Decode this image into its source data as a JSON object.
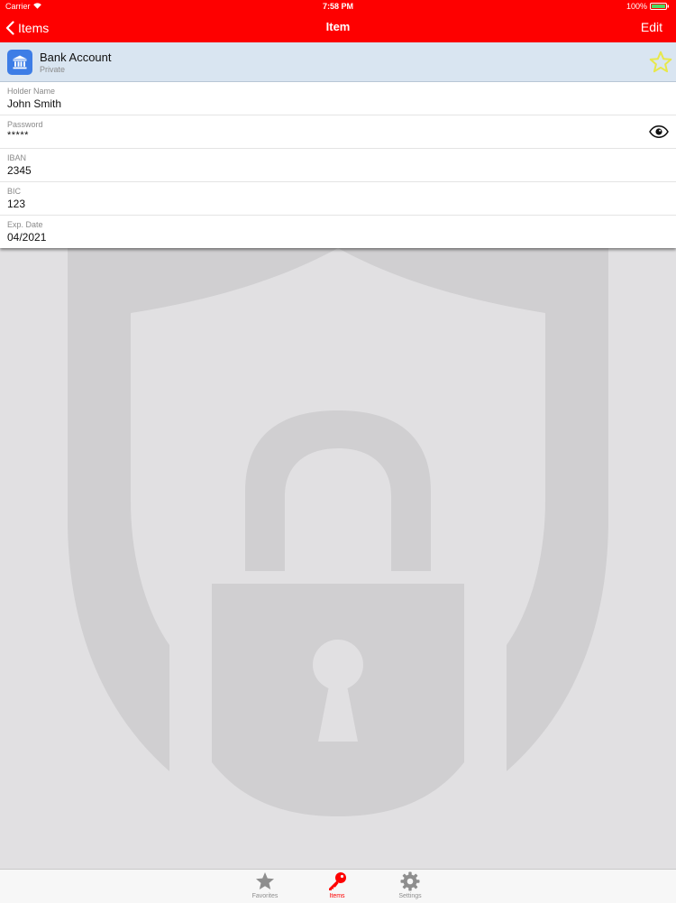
{
  "status_bar": {
    "carrier": "Carrier",
    "time": "7:58 PM",
    "battery": "100%"
  },
  "nav": {
    "back_label": "Items",
    "title": "Item",
    "edit_label": "Edit"
  },
  "item": {
    "title": "Bank Account",
    "subtitle": "Private",
    "icon": "bank-icon",
    "favorite_icon": "star-icon",
    "fields": [
      {
        "label": "Holder Name",
        "value": "John Smith"
      },
      {
        "label": "Password",
        "value": "*****"
      },
      {
        "label": "IBAN",
        "value": "2345"
      },
      {
        "label": "BIC",
        "value": "123"
      },
      {
        "label": "Exp. Date",
        "value": "04/2021"
      }
    ]
  },
  "tabs": [
    {
      "label": "Favorites",
      "icon": "star-icon",
      "active": false
    },
    {
      "label": "Items",
      "icon": "key-icon",
      "active": true
    },
    {
      "label": "Settings",
      "icon": "gear-icon",
      "active": false
    }
  ],
  "colors": {
    "brand": "#fe0000",
    "card_header": "#d9e5f1",
    "bank_icon": "#3d7de6",
    "star": "#e8e84a",
    "background": "#e1e0e2",
    "watermark": "#d0cfd1"
  }
}
